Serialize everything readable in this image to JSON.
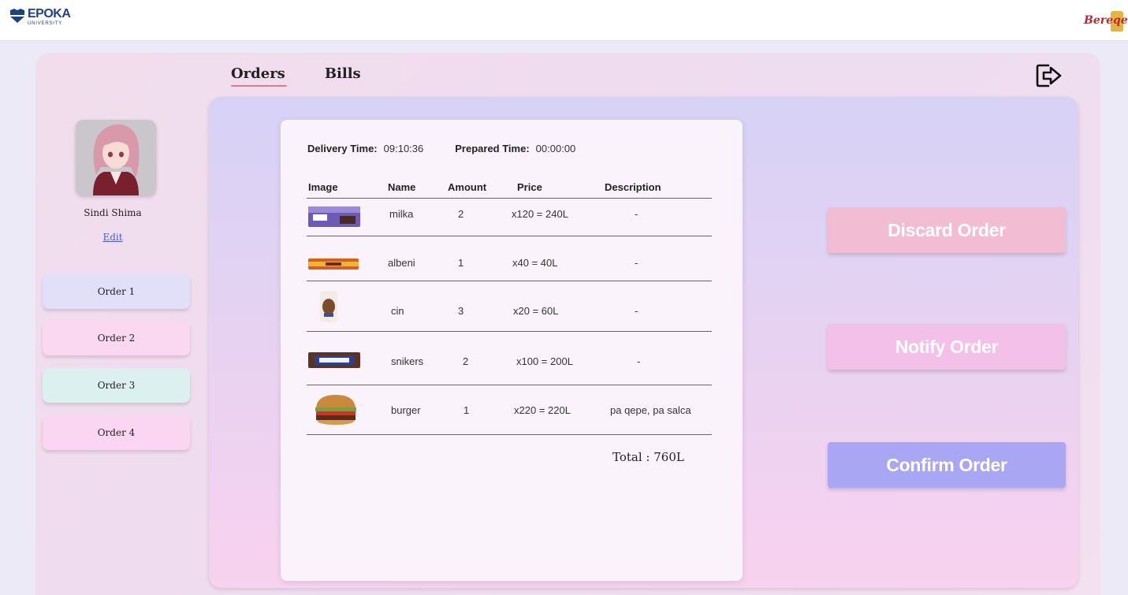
{
  "brand": {
    "left_logo": "EPOKA",
    "left_logo_sub": "UNIVERSITY",
    "right_logo": "Bereqet"
  },
  "nav": {
    "tabs": [
      {
        "label": "Orders",
        "active": true
      },
      {
        "label": "Bills",
        "active": false
      }
    ],
    "logout_icon": "logout-icon"
  },
  "profile": {
    "name": "Sindi Shima",
    "edit_label": "Edit"
  },
  "sidebar": {
    "orders": [
      {
        "label": "Order 1",
        "color": "#e2dff8"
      },
      {
        "label": "Order 2",
        "color": "#fbd8f1"
      },
      {
        "label": "Order 3",
        "color": "#dbf0ef"
      },
      {
        "label": "Order 4",
        "color": "#fad6f2"
      }
    ]
  },
  "order": {
    "delivery_label": "Delivery Time:",
    "delivery_time": "09:10:36",
    "prepared_label": "Prepared Time:",
    "prepared_time": "00:00:00",
    "columns": [
      "Image",
      "Name",
      "Amount",
      "Price",
      "Description"
    ],
    "items": [
      {
        "image": "milka-chocolate-image",
        "name": "milka",
        "amount": "2",
        "price": "x120 = 240L",
        "description": "-"
      },
      {
        "image": "albeni-bar-image",
        "name": "albeni",
        "amount": "1",
        "price": "x40 = 40L",
        "description": "-"
      },
      {
        "image": "cin-snack-image",
        "name": "cin",
        "amount": "3",
        "price": "x20 = 60L",
        "description": "-"
      },
      {
        "image": "snickers-bar-image",
        "name": "snikers",
        "amount": "2",
        "price": "x100 = 200L",
        "description": "-"
      },
      {
        "image": "burger-image",
        "name": "burger",
        "amount": "1",
        "price": "x220 = 220L",
        "description": "pa qepe, pa salca"
      }
    ],
    "total": "Total : 760L"
  },
  "actions": {
    "discard": {
      "label": "Discard Order",
      "color": "#f2bdd3"
    },
    "notify": {
      "label": "Notify Order",
      "color": "#f3c0ea"
    },
    "confirm": {
      "label": "Confirm Order",
      "color": "#a9a6f4"
    }
  }
}
